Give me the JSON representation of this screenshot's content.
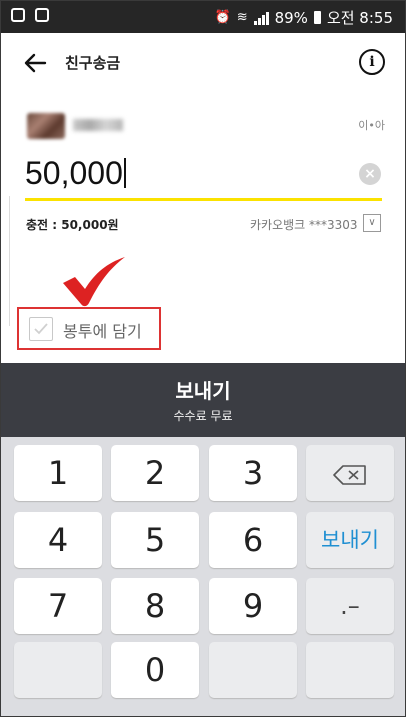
{
  "status_bar": {
    "battery": "89%",
    "time": "오전 8:55"
  },
  "header": {
    "title": "친구송금",
    "info_glyph": "i"
  },
  "recipient": {
    "limit_text": "이•아"
  },
  "amount": {
    "value": "50,000",
    "clear_glyph": "×"
  },
  "charge": {
    "text": "충전 : 50,000원",
    "bank_text": "카카오뱅크 ***3303",
    "bank_chevron": "∨"
  },
  "envelope": {
    "label": "봉투에 담기",
    "checked": false
  },
  "send_bar": {
    "title": "보내기",
    "subtitle": "수수료 무료"
  },
  "keypad": {
    "digits": [
      "1",
      "2",
      "3",
      "4",
      "5",
      "6",
      "7",
      "8",
      "9",
      "0"
    ],
    "send_label": "보내기",
    "dot_label": ".–"
  },
  "colors": {
    "accent_yellow": "#fbe200",
    "send_bar_bg": "#3b3d43",
    "send_key_text": "#1f8fd2",
    "annotation_red": "#dd2222"
  },
  "icons": [
    "back-arrow-icon",
    "info-icon",
    "clear-icon",
    "chevron-down-icon",
    "checkbox-icon",
    "backspace-icon"
  ]
}
